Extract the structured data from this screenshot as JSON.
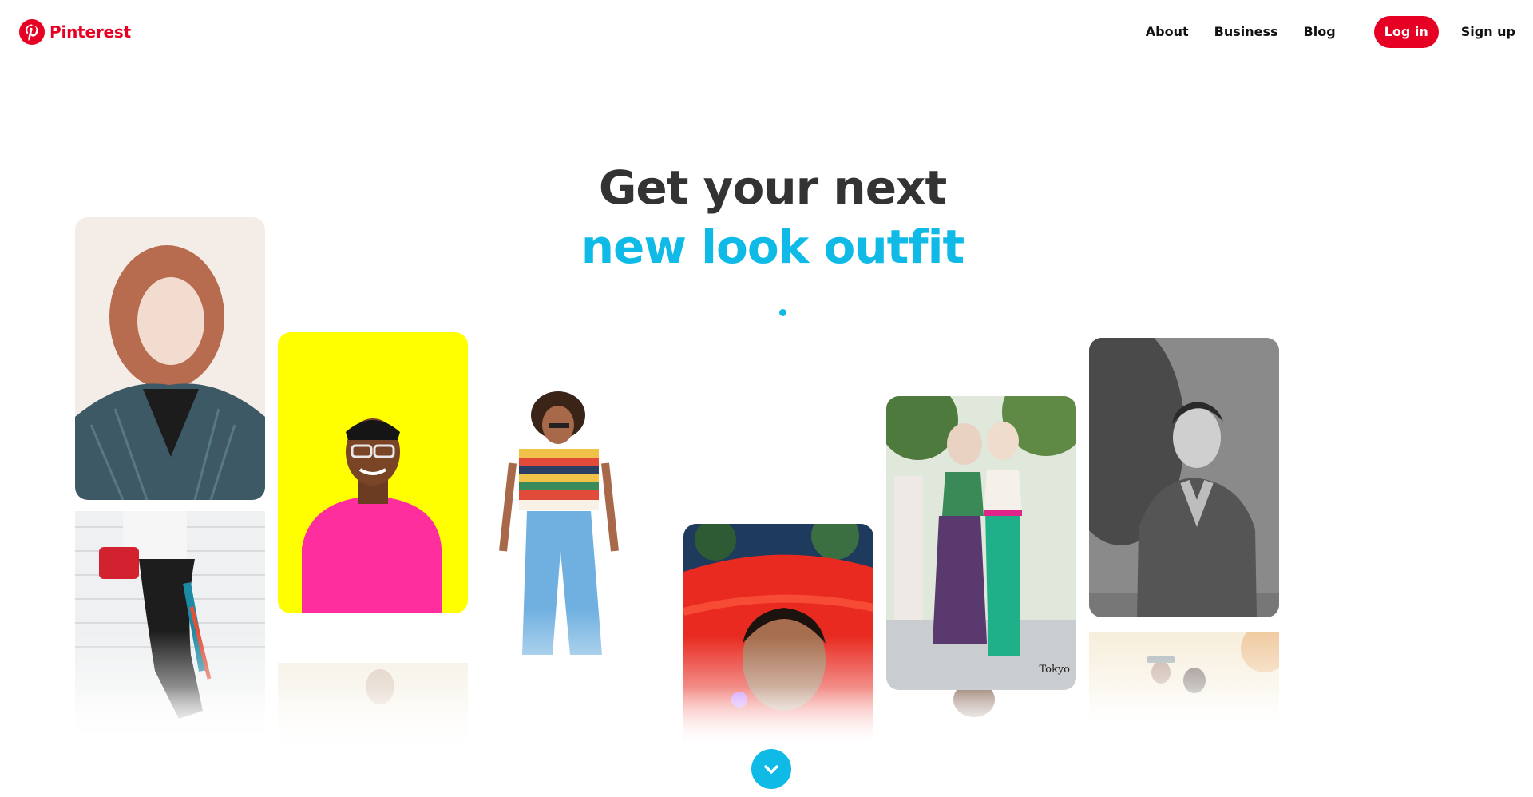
{
  "brand": {
    "name": "Pinterest",
    "logo_icon": "pinterest-logo-icon",
    "color": "#e60023"
  },
  "nav": {
    "about": "About",
    "business": "Business",
    "blog": "Blog",
    "login": "Log in",
    "signup": "Sign up"
  },
  "hero": {
    "line1": "Get your next",
    "line2": "new look outfit",
    "accent_color": "#0fbbe6",
    "text_color": "#333333"
  },
  "carousel": {
    "active_dot": 1,
    "dot_count": 1
  },
  "pins": {
    "watermark": "Tokyo"
  },
  "scroll_button": {
    "icon": "chevron-down-icon"
  }
}
